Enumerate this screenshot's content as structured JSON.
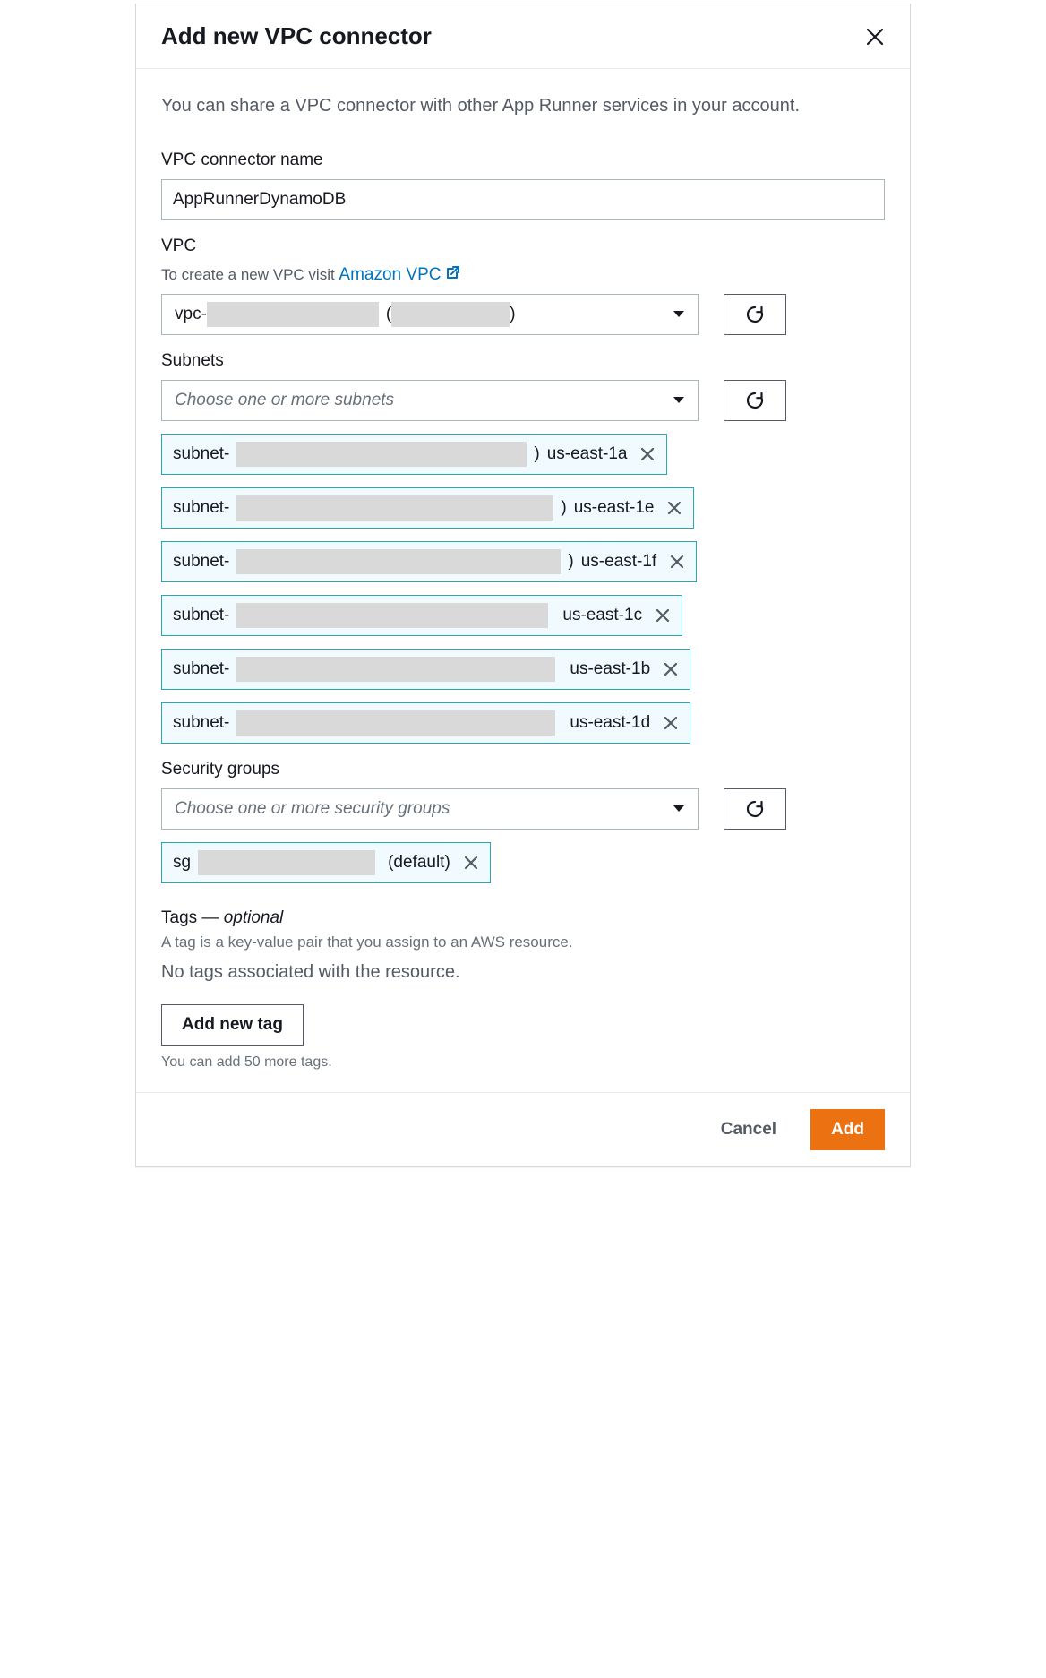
{
  "header": {
    "title": "Add new VPC connector"
  },
  "intro": "You can share a VPC connector with other App Runner services in your account.",
  "connectorName": {
    "label": "VPC connector name",
    "value": "AppRunnerDynamoDB"
  },
  "vpc": {
    "label": "VPC",
    "hint_prefix": "To create a new VPC visit ",
    "link_text": "Amazon VPC",
    "selected_prefix": "vpc-",
    "selected_suffix_open": "(",
    "selected_suffix_close": ")"
  },
  "subnets": {
    "label": "Subnets",
    "placeholder": "Choose one or more subnets",
    "items": [
      {
        "prefix": "subnet-",
        "redact_w": 324,
        "mid": ") ",
        "az": "us-east-1a"
      },
      {
        "prefix": "subnet-",
        "redact_w": 354,
        "mid": ") ",
        "az": "us-east-1e"
      },
      {
        "prefix": "subnet-",
        "redact_w": 362,
        "mid": ") ",
        "az": "us-east-1f"
      },
      {
        "prefix": "subnet-",
        "redact_w": 348,
        "mid": "",
        "az": "us-east-1c"
      },
      {
        "prefix": "subnet-",
        "redact_w": 356,
        "mid": "",
        "az": "us-east-1b"
      },
      {
        "prefix": "subnet-",
        "redact_w": 356,
        "mid": "",
        "az": "us-east-1d"
      }
    ]
  },
  "securityGroups": {
    "label": "Security groups",
    "placeholder": "Choose one or more security groups",
    "items": [
      {
        "prefix": "sg",
        "redact_w": 198,
        "suffix": "(default)"
      }
    ]
  },
  "tags": {
    "head_main": "Tags — ",
    "head_optional": "optional",
    "desc": "A tag is a key-value pair that you assign to an AWS resource.",
    "empty": "No tags associated with the resource.",
    "add_btn": "Add new tag",
    "limit_hint": "You can add 50 more tags."
  },
  "footer": {
    "cancel": "Cancel",
    "add": "Add"
  }
}
